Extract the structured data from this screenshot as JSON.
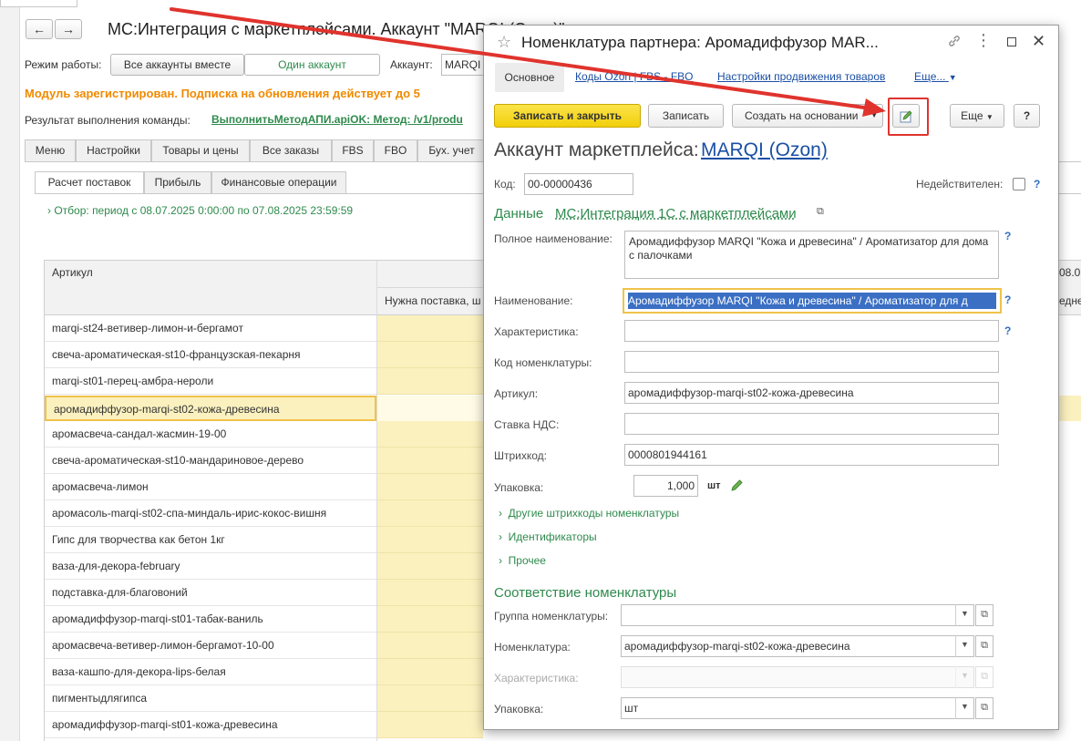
{
  "bg": {
    "nav_back": "←",
    "nav_forward": "→",
    "title": "МС:Интеграция с маркетплейсами. Аккаунт \"MAR",
    "title_rest": "QI (Ozon)\"",
    "mode_label": "Режим работы:",
    "mode_all": "Все аккаунты вместе",
    "mode_one": "Один аккаунт",
    "account_label": "Аккаунт:",
    "account_value": "MARQI",
    "module_status": "Модуль зарегистрирован. Подписка на обновления действует до 5",
    "result_label": "Результат выполнения команды:",
    "result_value": "ВыполнитьМетодАПИ.apiOK: Метод: /v1/produ",
    "tabs": [
      "Меню",
      "Настройки",
      "Товары и цены",
      "Все заказы",
      "FBS",
      "FBO",
      "Бух. учет"
    ],
    "subtabs": [
      "Расчет поставок",
      "Прибыль",
      "Финансовые операции"
    ],
    "filter": "Отбор: период с 08.07.2025 0:00:00 по 07.08.2025 23:59:59",
    "col_article": "Артикул",
    "col_need": "Нужна поставка, ш",
    "col_date_partial": "08.07",
    "col_right_partial": "едне",
    "rows": [
      "marqi-st24-ветивер-лимон-и-бергамот",
      "свеча-ароматическая-st10-французская-пекарня",
      "marqi-st01-перец-амбра-нероли",
      "аромадиффузор-marqi-st02-кожа-древесина",
      "аромасвеча-сандал-жасмин-19-00",
      "свеча-ароматическая-st10-мандариновое-дерево",
      "аромасвеча-лимон",
      "аромасоль-marqi-st02-спа-миндаль-ирис-кокос-вишня",
      "Гипс для творчества как бетон 1кг",
      "ваза-для-декора-february",
      "подставка-для-благовоний",
      "аромадиффузор-marqi-st01-табак-ваниль",
      "аромасвеча-ветивер-лимон-бергамот-10-00",
      "ваза-кашпо-для-декора-lips-белая",
      "пигментыдлягипса",
      "аромадиффузор-marqi-st01-кожа-древесина"
    ]
  },
  "dialog": {
    "star_icon": "☆",
    "title": "Номенклатура партнера: Аромадиффузор MAR...",
    "tabs": {
      "main": "Основное",
      "ozon_codes": "Коды Ozon | FBS - FBO",
      "promo": "Настройки продвижения товаров",
      "more": "Еще..."
    },
    "toolbar": {
      "save_close": "Записать и закрыть",
      "save": "Записать",
      "create_based": "Создать на основании",
      "more": "Еще",
      "help": "?"
    },
    "account_label": "Аккаунт маркетплейса:",
    "account_value": "MARQI (Ozon)",
    "code_label": "Код:",
    "code_value": "00-00000436",
    "invalid_label": "Недействителен:",
    "data_label": "Данные",
    "data_link": "МС:Интеграция 1С с маркетплейсами",
    "full_name_label": "Полное наименование:",
    "full_name_value": "Аромадиффузор MARQI \"Кожа и древесина\" / Ароматизатор для дома с палочками",
    "name_label": "Наименование:",
    "name_value": "Аромадиффузор MARQI \"Кожа и древесина\" / Ароматизатор для д",
    "char_label": "Характеристика:",
    "char_value": "",
    "nom_code_label": "Код номенклатуры:",
    "nom_code_value": "",
    "article_label": "Артикул:",
    "article_value": "аромадиффузор-marqi-st02-кожа-древесина",
    "vat_label": "Ставка НДС:",
    "vat_value": "",
    "barcode_label": "Штрихкод:",
    "barcode_value": "0000801944161",
    "pack_label": "Упаковка:",
    "pack_value": "1,000",
    "pack_unit": "шт",
    "other_barcodes": "Другие штрихкоды номенклатуры",
    "identifiers": "Идентификаторы",
    "other": "Прочее",
    "match_title": "Соответствие номенклатуры",
    "group_label": "Группа номенклатуры:",
    "group_value": "",
    "nomenclature_label": "Номенклатура:",
    "nomenclature_value": "аромадиффузор-marqi-st02-кожа-древесина",
    "characteristic_label": "Характеристика:",
    "characteristic_value": "",
    "packaging_label": "Упаковка:",
    "packaging_value": "шт"
  },
  "colors": {
    "accent_green": "#2f8a4d",
    "link_blue": "#1b4fa3",
    "highlight_yellow": "#fbf1bf",
    "primary_button": "#f5d40b",
    "annotation_red": "#e0332d"
  }
}
